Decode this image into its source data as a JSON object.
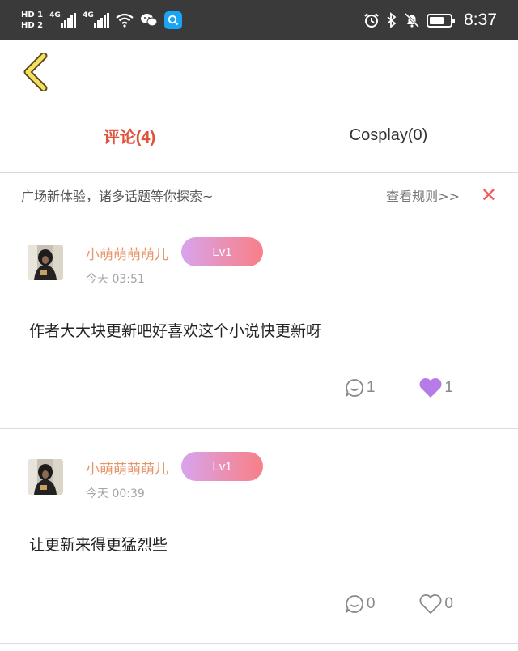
{
  "status_bar": {
    "hd1": "HD 1",
    "hd2": "HD 2",
    "net1": "4G",
    "net2": "4G",
    "time": "8:37",
    "icons": [
      "wifi-icon",
      "wechat-icon",
      "search-app-icon",
      "alarm-icon",
      "bluetooth-icon",
      "mute-bell-icon",
      "battery-icon"
    ]
  },
  "header": {
    "back_icon": "chevron-left-icon"
  },
  "tabs": [
    {
      "label": "评论(4)",
      "active": true
    },
    {
      "label": "Cosplay(0)",
      "active": false
    }
  ],
  "notice": {
    "text": "广场新体验，诸多话题等你探索~",
    "link": "查看规则>>",
    "close": "✕"
  },
  "comments": [
    {
      "username": "小萌萌萌萌儿",
      "level": "Lv1",
      "time": "今天 03:51",
      "content": "作者大大块更新吧好喜欢这个小说快更新呀",
      "reply_count": "1",
      "like_count": "1",
      "liked": true
    },
    {
      "username": "小萌萌萌萌儿",
      "level": "Lv1",
      "time": "今天 00:39",
      "content": "让更新来得更猛烈些",
      "reply_count": "0",
      "like_count": "0",
      "liked": false
    }
  ],
  "colors": {
    "accent": "#e0533a",
    "username": "#e7956a",
    "like_active": "#b57be6",
    "close": "#f05a5a"
  }
}
